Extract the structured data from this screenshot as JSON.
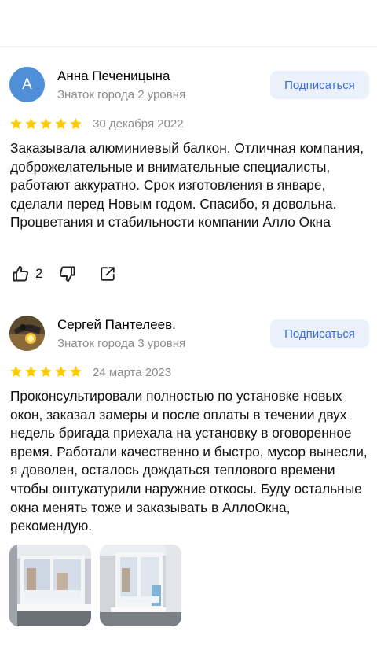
{
  "reviews": [
    {
      "avatar_letter": "А",
      "author": "Анна Печеницына",
      "level": "Знаток города 2 уровня",
      "subscribe_label": "Подписаться",
      "rating": 5,
      "date": "30 декабря 2022",
      "text": "Заказывала алюминиевый балкон. Отличная компания, доброжелательные и внимательные специалисты, работают аккуратно. Срок изготовления в январе, сделали перед Новым годом. Спасибо, я довольна. Процветания и стабильности компании Алло Окна",
      "likes": "2"
    },
    {
      "author": "Сергей Пантелеев.",
      "level": "Знаток города 3 уровня",
      "subscribe_label": "Подписаться",
      "rating": 5,
      "date": "24 марта 2023",
      "text": "Проконсультировали полностью по установке новых окон, заказал замеры и после оплаты в течении двух недель бригада приехала на установку в оговоренное время. Работали качественно и быстро, мусор вынесли, я доволен, осталось дождаться теплового времени чтобы оштукатурили наружние откосы. Буду остальные окна менять тоже и заказывать в АллоОкна, рекомендую."
    }
  ],
  "colors": {
    "star": "#fc0",
    "subscribe_bg": "#ebf1fb",
    "subscribe_text": "#3a6fd8",
    "avatar_bg": "#4f8fd8",
    "muted_text": "#8c8c8c"
  },
  "icons": [
    "thumb-up-icon",
    "thumb-down-icon",
    "share-icon",
    "star-icon"
  ]
}
